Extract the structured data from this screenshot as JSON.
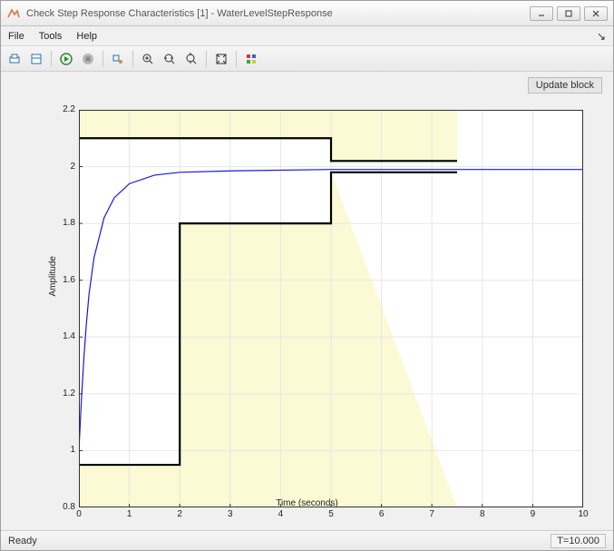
{
  "window": {
    "title": "Check Step Response Characteristics [1] - WaterLevelStepResponse"
  },
  "menu": {
    "file": "File",
    "tools": "Tools",
    "help": "Help"
  },
  "buttons": {
    "update_block": "Update block"
  },
  "status": {
    "ready": "Ready",
    "time": "T=10.000"
  },
  "chart_data": {
    "type": "line",
    "title": "",
    "xlabel": "Time (seconds)",
    "ylabel": "Amplitude",
    "xlim": [
      0,
      10
    ],
    "ylim": [
      0.8,
      2.2
    ],
    "xticks": [
      0,
      1,
      2,
      3,
      4,
      5,
      6,
      7,
      8,
      9,
      10
    ],
    "yticks": [
      0.8,
      1.0,
      1.2,
      1.4,
      1.6,
      1.8,
      2.0,
      2.2
    ],
    "response": {
      "x": [
        0,
        0.05,
        0.1,
        0.15,
        0.2,
        0.3,
        0.5,
        0.7,
        1.0,
        1.5,
        2.0,
        3.0,
        5.0,
        7.0,
        10.0
      ],
      "y": [
        1.0,
        1.18,
        1.33,
        1.45,
        1.55,
        1.68,
        1.82,
        1.89,
        1.94,
        1.97,
        1.98,
        1.985,
        1.99,
        1.99,
        1.99
      ]
    },
    "bound_upper": {
      "x": [
        0,
        5,
        5,
        7.5
      ],
      "y": [
        2.1,
        2.1,
        2.02,
        2.02
      ]
    },
    "bound_lower": {
      "x": [
        0,
        2,
        2,
        5,
        5,
        7.5
      ],
      "y": [
        0.95,
        0.95,
        1.8,
        1.8,
        1.98,
        1.98
      ]
    },
    "shade_lower_poly": {
      "x": [
        0,
        2,
        2,
        5,
        5,
        7.5,
        0
      ],
      "y": [
        0.95,
        0.95,
        1.8,
        1.8,
        1.98,
        0.8,
        0.8
      ]
    },
    "shade_upper_poly": {
      "x": [
        0,
        5,
        5,
        7.5,
        7.5,
        0
      ],
      "y": [
        2.1,
        2.1,
        2.02,
        2.02,
        2.2,
        2.2
      ]
    },
    "shade_color": "#fbfad4"
  }
}
